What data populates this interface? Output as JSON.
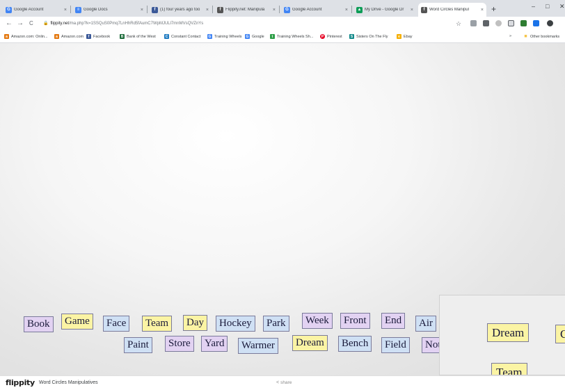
{
  "browser": {
    "tabs": [
      {
        "title": "Google Account",
        "fav": "G",
        "fav_color": "#4285f4",
        "close": "×"
      },
      {
        "title": "Google Docs",
        "fav": "≡",
        "fav_color": "#4285f4",
        "close": "×"
      },
      {
        "title": "(1) four years ago too",
        "fav": "f",
        "fav_color": "#3b5998",
        "close": "×"
      },
      {
        "title": "Flippity.net: Manipula",
        "fav": "f",
        "fav_color": "#555555",
        "close": "×"
      },
      {
        "title": "Google Account",
        "fav": "G",
        "fav_color": "#4285f4",
        "close": "×"
      },
      {
        "title": "My Drive - Google Dr",
        "fav": "▲",
        "fav_color": "#0f9d58",
        "close": "×"
      },
      {
        "title": "Word Circles Manipul",
        "fav": "f",
        "fav_color": "#555555",
        "close": "×"
      }
    ],
    "new_tab": "+",
    "window_controls": {
      "minimize": "–",
      "maximize": "□",
      "close": "✕"
    },
    "nav": {
      "back": "←",
      "forward": "→",
      "reload": "C"
    },
    "url": {
      "lock": "🔒",
      "host": "flippity.net",
      "path": "/ma.php?k=1SSQuS0Pmq7LnHhRd5fAumC7WpMJULl7mnMVsQVZnYs"
    },
    "star": "☆",
    "bookmarks": [
      {
        "label": "Amazon.com: Onlin...",
        "fav": "a",
        "fav_color": "#e47911"
      },
      {
        "label": "Amazon.com",
        "fav": "a",
        "fav_color": "#e47911"
      },
      {
        "label": "Facebook",
        "fav": "f",
        "fav_color": "#3b5998"
      },
      {
        "label": "Bank of the West",
        "fav": "B",
        "fav_color": "#1c6b3a"
      },
      {
        "label": "Constant Contact",
        "fav": "C",
        "fav_color": "#1f7bc1"
      },
      {
        "label": "Training Wheels",
        "fav": "G",
        "fav_color": "#4285f4"
      },
      {
        "label": "Google",
        "fav": "G",
        "fav_color": "#4285f4"
      },
      {
        "label": "Training Wheels Sh...",
        "fav": "t",
        "fav_color": "#2e9e48"
      },
      {
        "label": "Pinterest",
        "fav": "P",
        "fav_color": "#e60023"
      },
      {
        "label": "Sisters On The Fly",
        "fav": "S",
        "fav_color": "#138a8a"
      },
      {
        "label": "Ebay",
        "fav": "e",
        "fav_color": "#f5af02"
      }
    ],
    "bookmarks_more": "»",
    "other_bookmarks": {
      "label": "Other bookmarks",
      "fav": "■",
      "fav_color": "#f6c343"
    }
  },
  "colors": {
    "purple": "#e2d2f2",
    "yellow": "#fbf4a4",
    "blue": "#cfe0f4"
  },
  "words": [
    {
      "text": "Book",
      "color": "purple"
    },
    {
      "text": "Game",
      "color": "yellow"
    },
    {
      "text": "Face",
      "color": "blue"
    },
    {
      "text": "Team",
      "color": "yellow"
    },
    {
      "text": "Day",
      "color": "yellow"
    },
    {
      "text": "Hockey",
      "color": "blue"
    },
    {
      "text": "Park",
      "color": "blue"
    },
    {
      "text": "Week",
      "color": "purple"
    },
    {
      "text": "Front",
      "color": "purple"
    },
    {
      "text": "End",
      "color": "purple"
    },
    {
      "text": "Air",
      "color": "blue"
    },
    {
      "text": "Paint",
      "color": "blue"
    },
    {
      "text": "Store",
      "color": "purple"
    },
    {
      "text": "Yard",
      "color": "purple"
    },
    {
      "text": "Warmer",
      "color": "blue"
    },
    {
      "text": "Dream",
      "color": "yellow"
    },
    {
      "text": "Bench",
      "color": "blue"
    },
    {
      "text": "Field",
      "color": "blue"
    },
    {
      "text": "Not",
      "color": "purple"
    }
  ],
  "zoom_words": [
    {
      "text": "Dream",
      "color": "yellow"
    },
    {
      "text": "C",
      "color": "yellow"
    },
    {
      "text": "Team",
      "color": "yellow"
    }
  ],
  "footer": {
    "logo": "flippity",
    "title": "Word Circles Manipulatives",
    "share_icon": "<",
    "share": "share"
  }
}
